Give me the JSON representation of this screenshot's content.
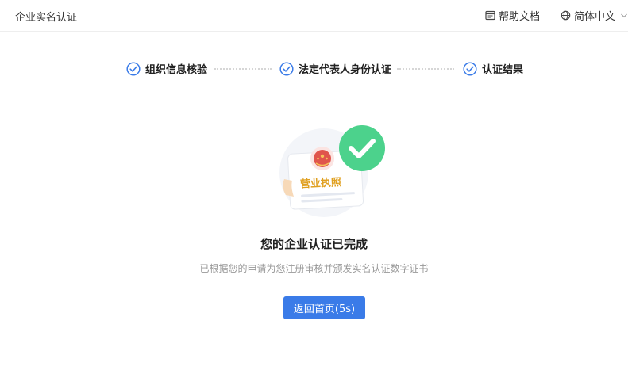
{
  "header": {
    "title": "企业实名认证",
    "help_label": "帮助文档",
    "language_label": "简体中文"
  },
  "steps": [
    {
      "label": "组织信息核验",
      "status": "done"
    },
    {
      "label": "法定代表人身份认证",
      "status": "done"
    },
    {
      "label": "认证结果",
      "status": "done"
    }
  ],
  "illustration": {
    "license_text": "营业执照"
  },
  "result": {
    "title": "您的企业认证已完成",
    "description": "已根据您的申请为您注册审核并颁发实名认证数字证书",
    "button_label": "返回首页(5s)"
  },
  "colors": {
    "accent": "#3a7be8",
    "success": "#4cd28c",
    "seal": "#e0554c",
    "license_text": "#e0a020"
  }
}
